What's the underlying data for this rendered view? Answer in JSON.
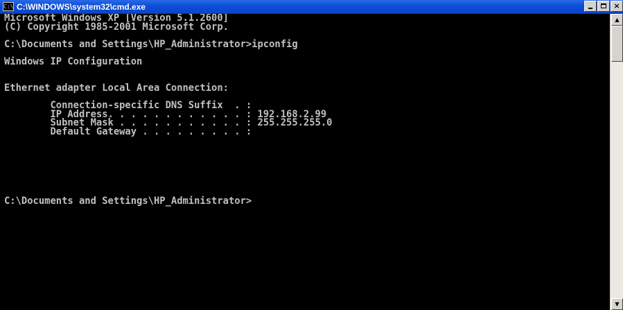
{
  "window": {
    "title": "C:\\WINDOWS\\system32\\cmd.exe",
    "icon": "cmd-icon",
    "icon_glyph": "C:\\",
    "minimize_label": "",
    "maximize_label": "",
    "close_label": "×"
  },
  "console": {
    "lines": [
      "Microsoft Windows XP [Version 5.1.2600]",
      "(C) Copyright 1985-2001 Microsoft Corp.",
      "",
      "C:\\Documents and Settings\\HP_Administrator>ipconfig",
      "",
      "Windows IP Configuration",
      "",
      "",
      "Ethernet adapter Local Area Connection:",
      "",
      "        Connection-specific DNS Suffix  . :",
      "        IP Address. . . . . . . . . . . . : 192.168.2.99",
      "        Subnet Mask . . . . . . . . . . . : 255.255.255.0",
      "        Default Gateway . . . . . . . . . :",
      "",
      "",
      "",
      "",
      "",
      "",
      "",
      "C:\\Documents and Settings\\HP_Administrator>"
    ]
  },
  "scrollbar": {
    "up_glyph": "▲",
    "down_glyph": "▼"
  },
  "colors": {
    "console_bg": "#000000",
    "console_text": "#c0c0c0",
    "titlebar": "#0c4ed8"
  }
}
